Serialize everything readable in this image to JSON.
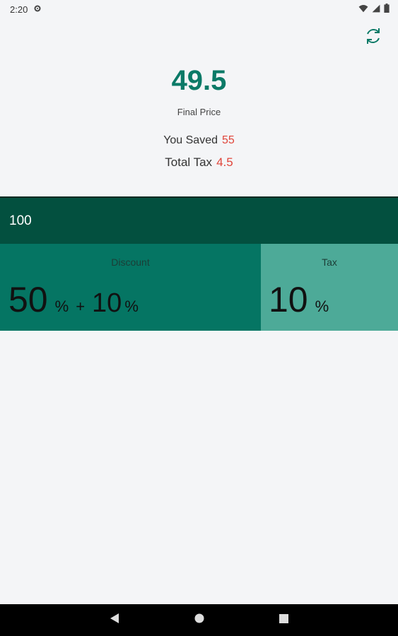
{
  "status_bar": {
    "time": "2:20"
  },
  "result": {
    "final_price": "49.5",
    "final_price_label": "Final Price",
    "saved_label": "You Saved",
    "saved_value": "55",
    "tax_label": "Total Tax",
    "tax_value": "4.5"
  },
  "input": {
    "price": "100"
  },
  "discount": {
    "label": "Discount",
    "value1": "50",
    "value2": "10",
    "percent_sign": "%",
    "plus": "+"
  },
  "tax": {
    "label": "Tax",
    "value": "10",
    "percent_sign": "%"
  },
  "colors": {
    "accent": "#0b7a67",
    "highlight": "#e0453a",
    "input_bar": "#03503f",
    "discount_panel": "#057563",
    "tax_panel": "#4daa98"
  },
  "icons": {
    "settings": "gear-icon",
    "wifi": "wifi-icon",
    "signal": "signal-icon",
    "battery": "battery-icon",
    "refresh": "refresh-icon",
    "back": "back-icon",
    "home": "home-icon",
    "recents": "recents-icon"
  }
}
